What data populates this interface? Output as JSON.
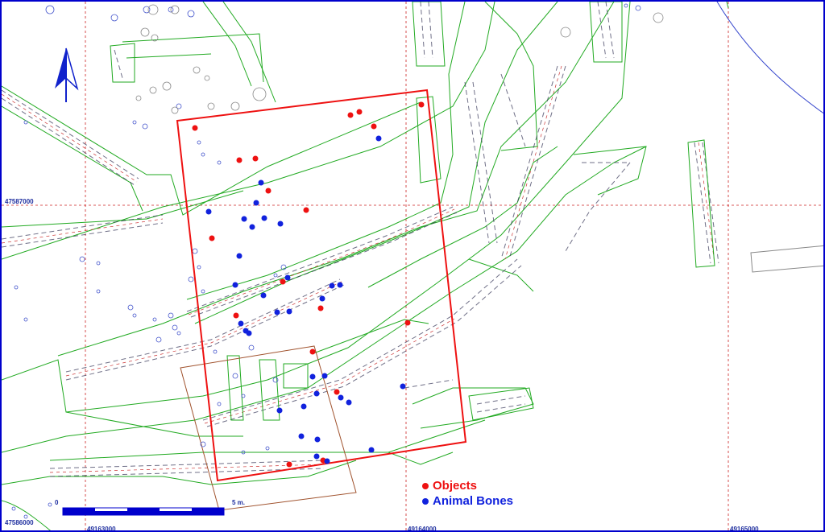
{
  "map": {
    "coordinates": {
      "y_top": "47587000",
      "y_bottom": "47586000",
      "x_left": "49163000",
      "x_mid": "49164000",
      "x_right": "49165000"
    },
    "scale": {
      "start_label": "0",
      "end_label": "5 m."
    },
    "legend": {
      "objects_label": "Objects",
      "bones_label": "Animal Bones"
    },
    "colors": {
      "grid": "#cc2222",
      "trench": "#ee1111",
      "contours": "#22aa22",
      "stones": "#4455cc",
      "objects": "#ee1111",
      "bones": "#1122dd",
      "frame": "#0000cc",
      "excavation_box": "#a0522d",
      "north_arrow": "#1122cc"
    },
    "icons": {
      "north": "north-arrow-icon"
    },
    "finds": {
      "objects": [
        [
          521,
          128
        ],
        [
          433,
          141
        ],
        [
          444,
          137
        ],
        [
          462,
          155
        ],
        [
          240,
          157
        ],
        [
          295,
          197
        ],
        [
          315,
          195
        ],
        [
          331,
          235
        ],
        [
          378,
          259
        ],
        [
          261,
          294
        ],
        [
          349,
          348
        ],
        [
          291,
          390
        ],
        [
          396,
          381
        ],
        [
          504,
          399
        ],
        [
          386,
          435
        ],
        [
          416,
          485
        ],
        [
          357,
          575
        ],
        [
          399,
          570
        ]
      ],
      "animal_bones": [
        [
          468,
          170
        ],
        [
          322,
          225
        ],
        [
          316,
          250
        ],
        [
          257,
          261
        ],
        [
          301,
          270
        ],
        [
          326,
          269
        ],
        [
          311,
          280
        ],
        [
          346,
          276
        ],
        [
          295,
          316
        ],
        [
          290,
          352
        ],
        [
          355,
          343
        ],
        [
          410,
          353
        ],
        [
          420,
          352
        ],
        [
          398,
          369
        ],
        [
          325,
          365
        ],
        [
          342,
          386
        ],
        [
          357,
          385
        ],
        [
          297,
          400
        ],
        [
          303,
          409
        ],
        [
          307,
          412
        ],
        [
          386,
          466
        ],
        [
          401,
          465
        ],
        [
          391,
          487
        ],
        [
          421,
          492
        ],
        [
          431,
          498
        ],
        [
          498,
          478
        ],
        [
          375,
          503
        ],
        [
          345,
          508
        ],
        [
          372,
          540
        ],
        [
          392,
          544
        ],
        [
          459,
          557
        ],
        [
          391,
          565
        ],
        [
          404,
          571
        ]
      ]
    }
  }
}
